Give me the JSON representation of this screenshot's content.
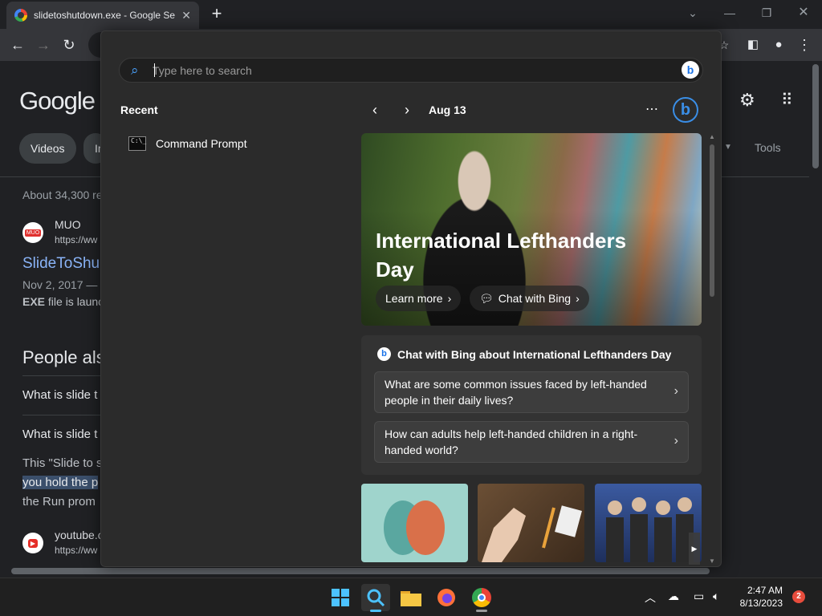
{
  "browser": {
    "tab_title": "slidetoshutdown.exe - Google Se",
    "new_tab_label": "+"
  },
  "google": {
    "logo": "Google",
    "chips": [
      "Videos",
      "Im"
    ],
    "tools_label": "Tools",
    "result_count": "About 34,300 re",
    "result1": {
      "site": "MUO",
      "url": "https://ww",
      "title": "SlideToShu",
      "date": "Nov 2, 2017 — C",
      "snippet_bold": "EXE",
      "snippet": " file is launc"
    },
    "people_also": "People als",
    "paa": [
      "What is slide t",
      "What is slide t"
    ],
    "answer_lines": [
      "This \"Slide to s",
      "you hold the p",
      "the Run prom"
    ],
    "result2": {
      "site": "youtube.c",
      "url": "https://ww"
    }
  },
  "start_menu": {
    "search": {
      "placeholder": "Type here to search"
    },
    "recent_label": "Recent",
    "recent_items": [
      {
        "label": "Command Prompt",
        "icon": "cmd-icon"
      }
    ],
    "date": "Aug 13",
    "hero": {
      "title": "International Lefthanders Day",
      "learn_more": "Learn more",
      "chat_with_bing": "Chat with Bing"
    },
    "chat_card": {
      "heading": "Chat with Bing about International Lefthanders Day",
      "questions": [
        "What are some common issues faced by left-handed people in their daily lives?",
        "How can adults help left-handed children in a right-handed world?"
      ]
    }
  },
  "taskbar": {
    "time": "2:47 AM",
    "date": "8/13/2023",
    "notification_count": "2"
  }
}
